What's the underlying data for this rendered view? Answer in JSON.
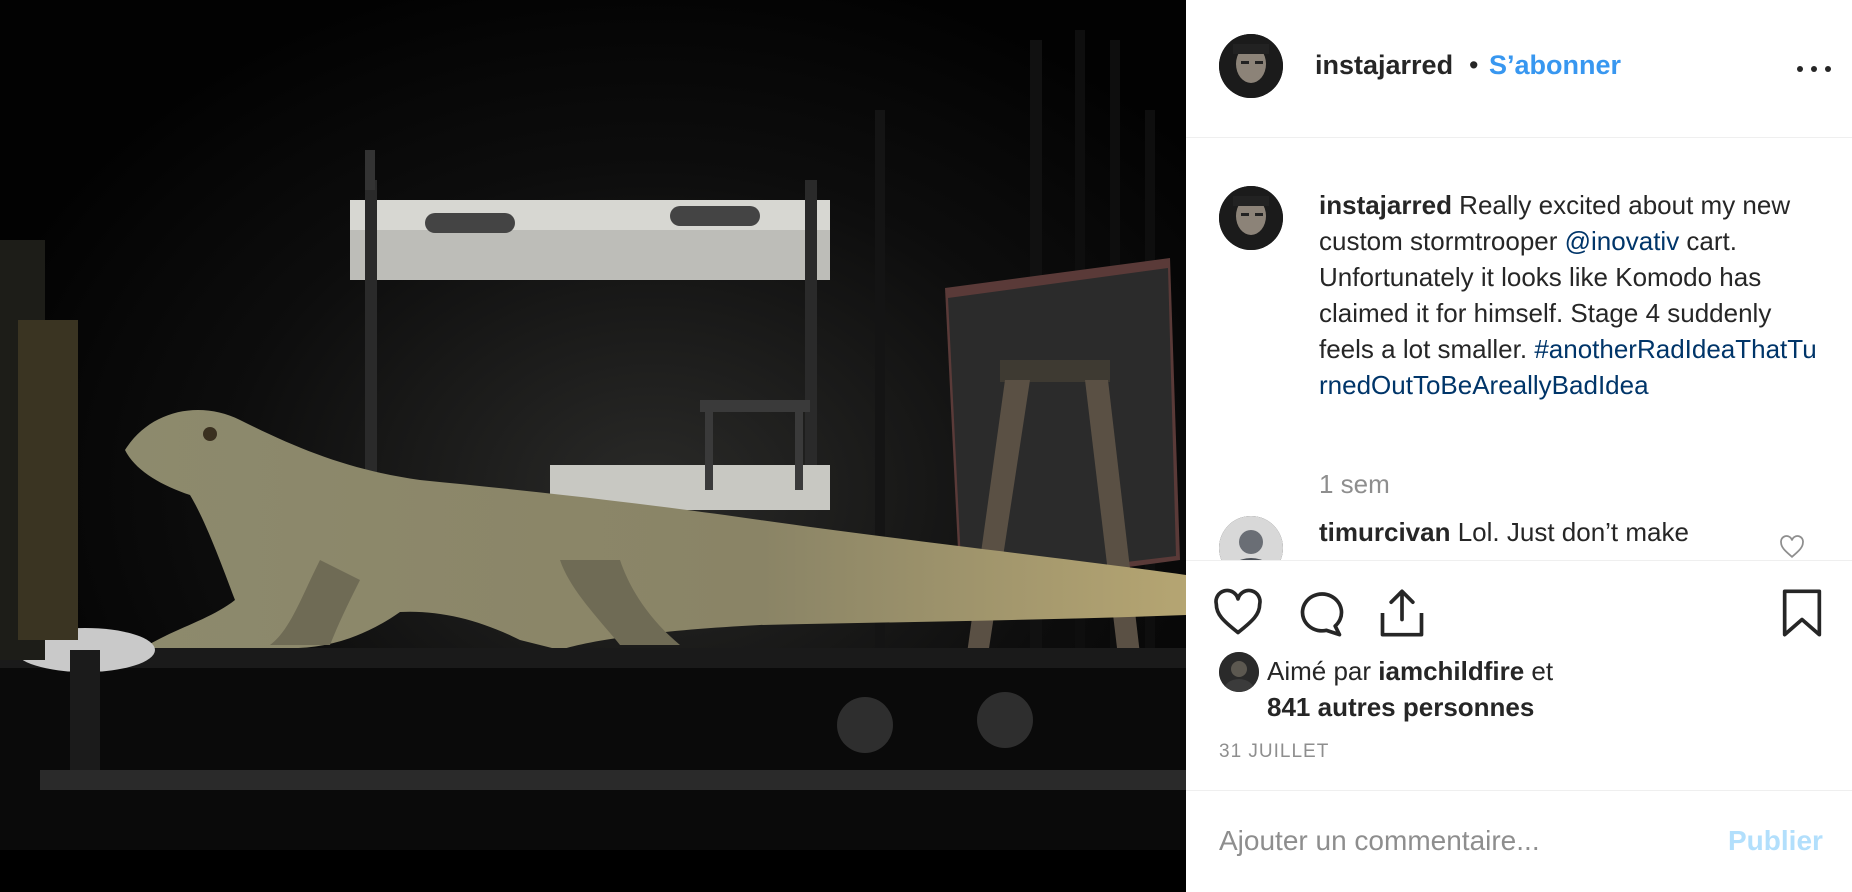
{
  "post": {
    "author": "instajarred",
    "separator": "•",
    "follow_label": "S’abonner",
    "more_label": "Plus d’options",
    "caption": {
      "username": "instajarred",
      "text_before_mention": " Really excited about my new custom stormtrooper ",
      "mention": "@inovativ",
      "text_after_mention": " cart. Unfortunately it looks like Komodo has claimed it for himself. Stage 4 suddenly feels a lot smaller. ",
      "hashtag": "#anotherRadIdeaThatTurnedOutToBeAreallyBadIdea",
      "time": "1 sem"
    },
    "comments": [
      {
        "username": "timurcivan",
        "text": " Lol. Just don’t make"
      }
    ],
    "likes": {
      "prefix": "Aimé par ",
      "user": "iamchildfire",
      "conjunction": " et",
      "others": "841 autres personnes"
    },
    "date": "31 JUILLET",
    "add_comment": {
      "placeholder": "Ajouter un commentaire...",
      "submit_label": "Publier"
    }
  },
  "colors": {
    "link_blue": "#3897f0",
    "hashtag_blue": "#003569",
    "publish_disabled": "#b2dffc",
    "muted": "#8e8e8e",
    "text": "#262626"
  },
  "icons": {
    "like": "heart-icon",
    "comment": "comment-bubble-icon",
    "share": "share-upload-icon",
    "save": "bookmark-icon",
    "more": "more-horizontal-icon",
    "comment_like": "small-heart-icon"
  }
}
